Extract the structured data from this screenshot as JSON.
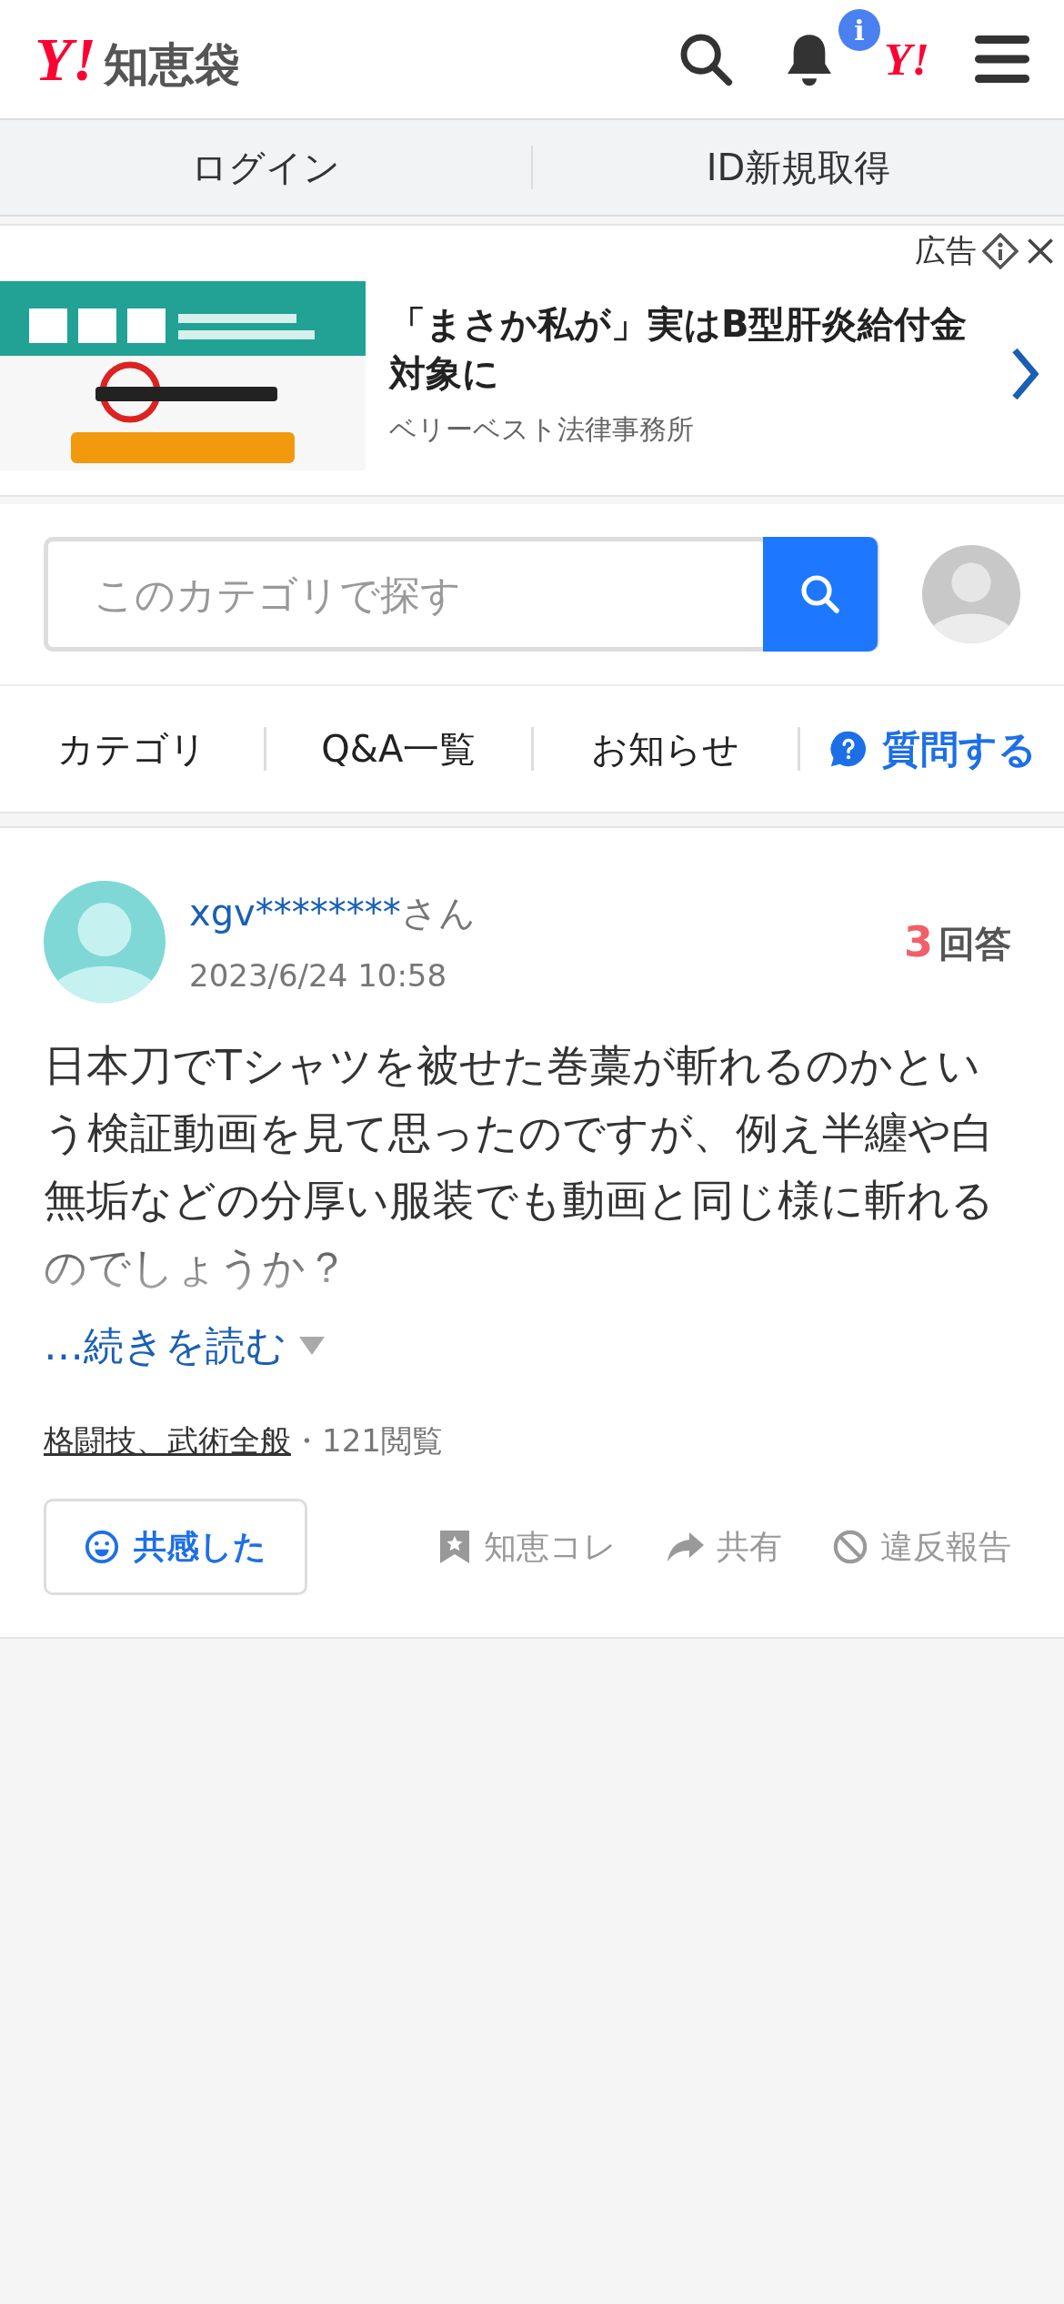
{
  "header": {
    "logo_mark": "Y!",
    "logo_text": "知恵袋",
    "notification_badge": "i",
    "account_mark": "Y!"
  },
  "auth_bar": [
    "ログイン",
    "ID新規取得"
  ],
  "ad": {
    "label": "広告",
    "title": "「まさか私が」実はB型肝炎給付金対象に",
    "advertiser": "ベリーベスト法律事務所"
  },
  "search": {
    "placeholder": "このカテゴリで探す"
  },
  "nav": [
    {
      "label": "カテゴリ",
      "kind": "link"
    },
    {
      "label": "Q&A一覧",
      "kind": "link"
    },
    {
      "label": "お知らせ",
      "kind": "link"
    },
    {
      "label": "質問する",
      "kind": "action"
    }
  ],
  "question": {
    "user": "xgv********",
    "honorific": "さん",
    "date": "2023/6/24 10:58",
    "answer_count": "3",
    "answer_label": "回答",
    "body": "日本刀でTシャツを被せた巻藁が斬れるのかという検証動画を見て思ったのですが、例え半纏や白無垢などの分厚い服装でも動画と同じ様に斬れるのでしょうか？",
    "read_more": "…続きを読む",
    "category": "格闘技、武術全般",
    "views": "・121閲覧",
    "empathy_button": "共感した",
    "actions": [
      {
        "label": "知恵コレ",
        "kind": "collect"
      },
      {
        "label": "共有",
        "kind": "share"
      },
      {
        "label": "違反報告",
        "kind": "report"
      }
    ]
  }
}
